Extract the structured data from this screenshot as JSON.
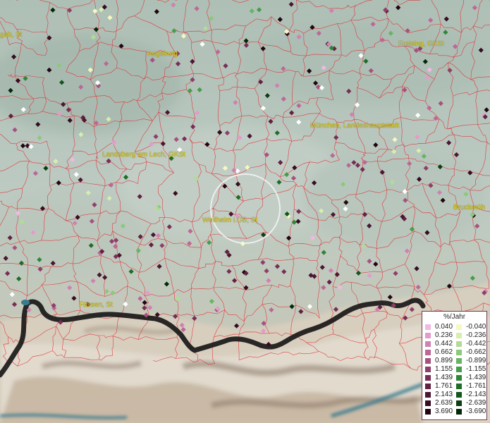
{
  "places": [
    {
      "id": "gab",
      "label": "gab, St"
    },
    {
      "id": "augsburg",
      "label": "Augsburg"
    },
    {
      "id": "freising",
      "label": "Freising, GKSt"
    },
    {
      "id": "muenchen",
      "label": "München, Landeshauptstadt"
    },
    {
      "id": "landsberg",
      "label": "Landsberg am Lech, GKSt"
    },
    {
      "id": "weilheim",
      "label": "Weilheim i.OB, St"
    },
    {
      "id": "bruckmuehl",
      "label": "Bruckmüh"
    },
    {
      "id": "fuessen",
      "label": "Füssen, St"
    }
  ],
  "legend": {
    "title": "%/Jahr",
    "positive": [
      {
        "value": "0.040",
        "color": "#f2b7e3"
      },
      {
        "value": "0.236",
        "color": "#e39bcc"
      },
      {
        "value": "0.442",
        "color": "#d081b2"
      },
      {
        "value": "0.662",
        "color": "#bc6897"
      },
      {
        "value": "0.899",
        "color": "#a5527f"
      },
      {
        "value": "1.155",
        "color": "#8e3f69"
      },
      {
        "value": "1.439",
        "color": "#772e55"
      },
      {
        "value": "1.761",
        "color": "#612142"
      },
      {
        "value": "2.143",
        "color": "#4b1631"
      },
      {
        "value": "2.639",
        "color": "#360c20"
      },
      {
        "value": "3.690",
        "color": "#200611"
      }
    ],
    "negative": [
      {
        "value": "-0.040",
        "color": "#f5f9c0"
      },
      {
        "value": "-0.236",
        "color": "#d7eeac"
      },
      {
        "value": "-0.442",
        "color": "#b2dc94"
      },
      {
        "value": "-0.662",
        "color": "#8cc97b"
      },
      {
        "value": "-0.899",
        "color": "#67b563"
      },
      {
        "value": "-1.155",
        "color": "#479d4b"
      },
      {
        "value": "-1.439",
        "color": "#2f8638"
      },
      {
        "value": "-1.761",
        "color": "#1e6d28"
      },
      {
        "value": "-2.143",
        "color": "#12561c"
      },
      {
        "value": "-2.639",
        "color": "#093f11"
      },
      {
        "value": "-3.690",
        "color": "#032808"
      }
    ]
  },
  "colors": {
    "boundary": "#e4242b",
    "border_line": "#161616",
    "lake": "#3b7a8e",
    "terrain_plain": "#b9c7bf",
    "terrain_mountain": "#d8c6b2",
    "zero_change": "#ffffff"
  }
}
